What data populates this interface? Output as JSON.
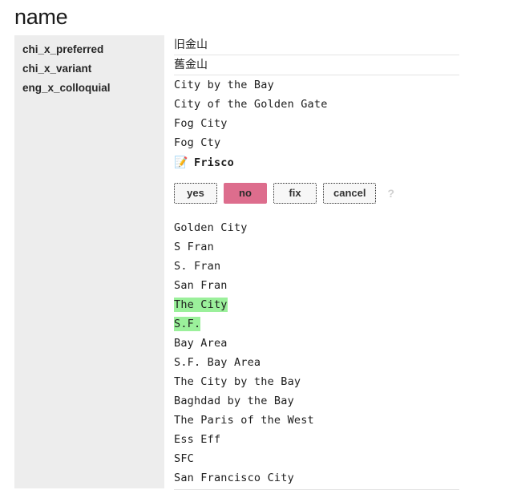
{
  "page": {
    "title": "name"
  },
  "sidebar": {
    "items": [
      {
        "label": "chi_x_preferred"
      },
      {
        "label": "chi_x_variant"
      },
      {
        "label": "eng_x_colloquial"
      }
    ]
  },
  "content": {
    "chi_preferred": [
      {
        "text": "旧金山"
      }
    ],
    "chi_variant": [
      {
        "text": "舊金山"
      }
    ],
    "eng_colloquial_before": [
      {
        "text": "City by the Bay"
      },
      {
        "text": "City of the Golden Gate"
      },
      {
        "text": "Fog City"
      },
      {
        "text": "Fog Cty"
      }
    ],
    "candidate": {
      "icon": "memo-pencil-icon",
      "icon_glyph": "📝",
      "text": "Frisco"
    },
    "actions": {
      "yes_label": "yes",
      "no_label": "no",
      "fix_label": "fix",
      "cancel_label": "cancel",
      "help_label": "?"
    },
    "eng_colloquial_after": [
      {
        "text": "Golden City",
        "highlight": false
      },
      {
        "text": "S Fran",
        "highlight": false
      },
      {
        "text": "S. Fran",
        "highlight": false
      },
      {
        "text": "San Fran",
        "highlight": false
      },
      {
        "text": "The City",
        "highlight": true
      },
      {
        "text": "S.F.",
        "highlight": true
      },
      {
        "text": "Bay Area",
        "highlight": false
      },
      {
        "text": "S.F. Bay Area",
        "highlight": false
      },
      {
        "text": "The City by the Bay",
        "highlight": false
      },
      {
        "text": "Baghdad by the Bay",
        "highlight": false
      },
      {
        "text": "The Paris of the West",
        "highlight": false
      },
      {
        "text": "Ess Eff",
        "highlight": false
      },
      {
        "text": "SFC",
        "highlight": false
      },
      {
        "text": "San Francisco City",
        "highlight": false
      }
    ]
  },
  "colors": {
    "sidebar_bg": "#ededed",
    "highlight_green": "#9bf09b",
    "danger_pink": "#dd6d8d",
    "separator": "#e4e4e4"
  }
}
